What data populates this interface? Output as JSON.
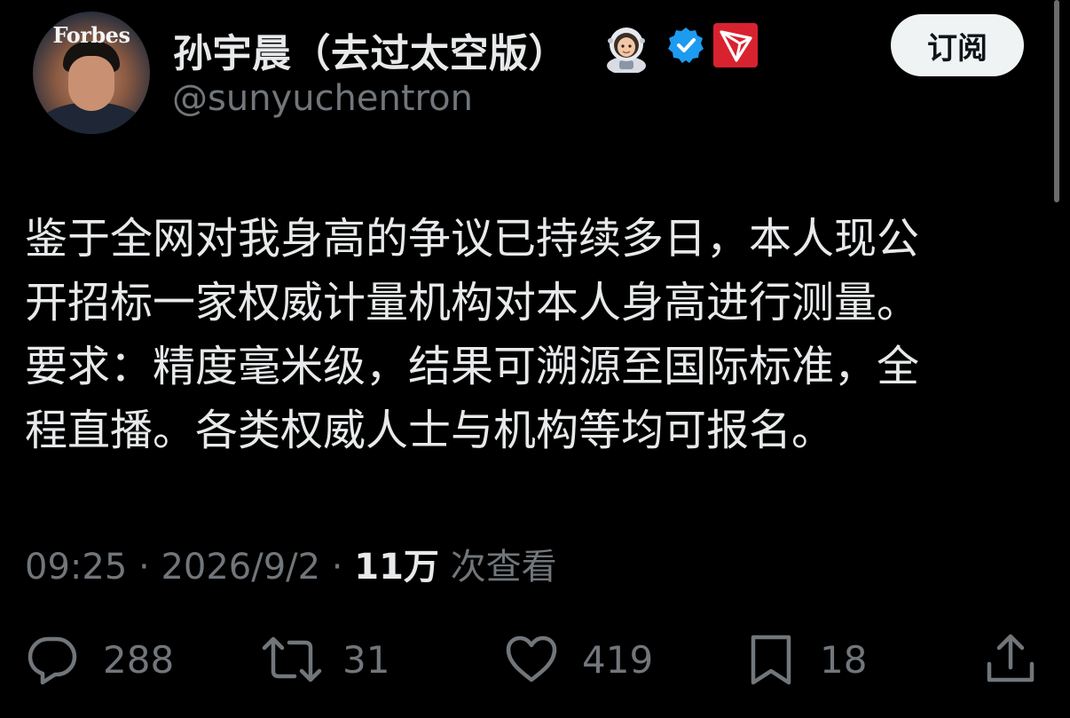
{
  "author": {
    "display_name": "孙宇晨（去过太空版）",
    "handle": "@sunyuchentron",
    "avatar_label": "Forbes"
  },
  "header": {
    "subscribe_label": "订阅"
  },
  "tweet": {
    "text_lines": [
      "鉴于全网对我身高的争议已持续多日，本人现公",
      "开招标一家权威计量机构对本人身高进行测量。",
      "要求：精度毫米级，结果可溯源至国际标准，全",
      "程直播。各类权威人士与机构等均可报名。"
    ],
    "time": "09:25",
    "date": "2026/9/2",
    "views_count": "11万",
    "views_label": "次查看"
  },
  "actions": {
    "replies": "288",
    "retweets": "31",
    "likes": "419",
    "bookmarks": "18"
  },
  "icons": {
    "astronaut": "astronaut-emoji-icon",
    "verified": "verified-badge-icon",
    "tron": "tron-logo-icon",
    "reply": "reply-icon",
    "retweet": "retweet-icon",
    "like": "heart-icon",
    "bookmark": "bookmark-icon",
    "share": "share-icon"
  },
  "colors": {
    "background": "#000000",
    "text": "#e7e9ea",
    "secondary": "#71767b",
    "verified": "#1d9bf0",
    "tron_red": "#d9222f"
  }
}
